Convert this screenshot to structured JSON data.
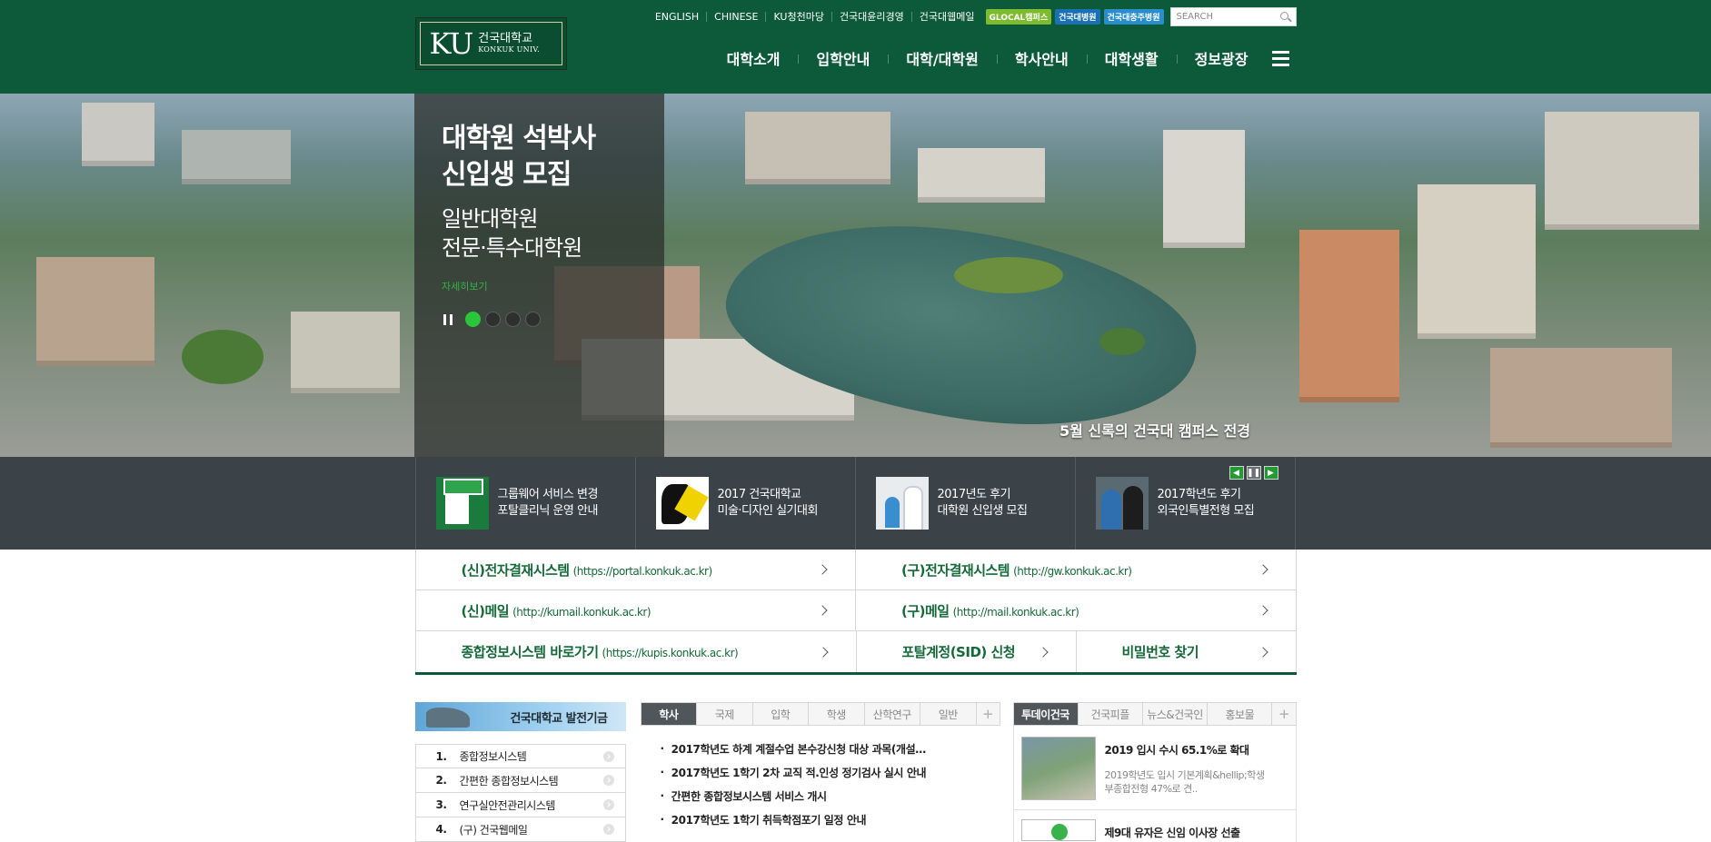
{
  "header": {
    "logo": {
      "mark": "KU",
      "name_ko": "건국대학교",
      "name_en": "KONKUK UNIV."
    },
    "util_links": [
      "ENGLISH",
      "CHINESE",
      "KU청천마당",
      "건국대윤리경영",
      "건국대웹메일"
    ],
    "badges": [
      "GLOCAL캠퍼스",
      "건국대병원",
      "건국대충주병원"
    ],
    "search_placeholder": "SEARCH",
    "gnb": [
      "대학소개",
      "입학안내",
      "대학/대학원",
      "학사안내",
      "대학생활",
      "정보광장"
    ]
  },
  "visual": {
    "title": [
      "대학원 석박사",
      "신입생 모집"
    ],
    "subtitle": [
      "일반대학원",
      "전문·특수대학원"
    ],
    "more": "자세히보기",
    "slide_count": 4,
    "active_slide": 1,
    "caption": "5월 신록의 건국대 캠퍼스 전경"
  },
  "banners": [
    {
      "line1": "그룹웨어 서비스 변경",
      "line2": "포탈클리닉 운영 안내"
    },
    {
      "line1": "2017 건국대학교",
      "line2": "미술·디자인 실기대회"
    },
    {
      "line1": "2017년도 후기",
      "line2": "대학원 신입생 모집"
    },
    {
      "line1": "2017학년도 후기",
      "line2": "외국인특별전형 모집"
    }
  ],
  "quick_links": [
    [
      {
        "label": "(신)전자결재시스템",
        "url": "(https://portal.konkuk.ac.kr)"
      },
      {
        "label": "(구)전자결재시스템",
        "url": "(http://gw.konkuk.ac.kr)"
      }
    ],
    [
      {
        "label": "(신)메일",
        "url": "(http://kumail.konkuk.ac.kr)"
      },
      {
        "label": "(구)메일",
        "url": "(http://mail.konkuk.ac.kr)"
      }
    ],
    [
      {
        "label": "종합정보시스템 바로가기",
        "url": "(https://kupis.konkuk.ac.kr)"
      },
      {
        "label": "포탈계정(SID) 신청",
        "url": ""
      },
      {
        "label": "비밀번호 찾기",
        "url": ""
      }
    ]
  ],
  "fund_banner": "건국대학교 발전기금",
  "systems": [
    {
      "num": "1.",
      "label": "종합정보시스템"
    },
    {
      "num": "2.",
      "label": "간편한 종합정보시스템"
    },
    {
      "num": "3.",
      "label": "연구실안전관리시스템"
    },
    {
      "num": "4.",
      "label": "(구) 건국웹메일"
    }
  ],
  "notice_tabs": [
    "학사",
    "국제",
    "입학",
    "학생",
    "산학연구",
    "일반"
  ],
  "notices": [
    "2017학년도 하계 계절수업 본수강신청 대상 과목(개설…",
    "2017학년도 1학기 2차 교직 적.인성 정기검사 실시 안내",
    "간편한 종합정보시스템 서비스 개시",
    "2017학년도 1학기 취득학점포기 일정 안내"
  ],
  "news_tabs": [
    "투데이건국",
    "건국피플",
    "뉴스&건국인",
    "홍보물"
  ],
  "news": {
    "title": "2019 입시 수시 65.1%로 확대",
    "desc": [
      "2019학년도 입시 기본계획&hellip;학생",
      "부종합전형 47%로 견.."
    ],
    "title2": "제9대 유자은 신임 이사장 선출"
  },
  "colors": {
    "header_green": "#0c5a3a",
    "link_green": "#156938",
    "active_dot": "#29c53a"
  }
}
